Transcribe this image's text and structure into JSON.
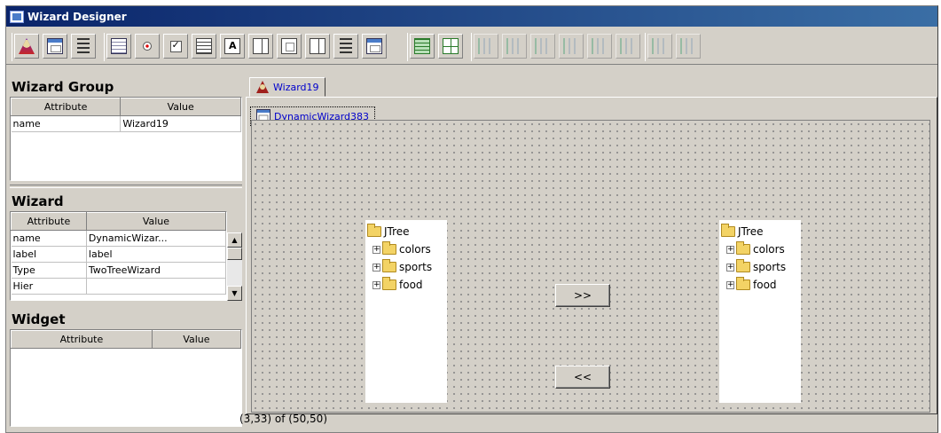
{
  "window": {
    "title": "Wizard Designer"
  },
  "toolbar": {
    "groups": [
      [
        "wizard-icon",
        "dialog-icon",
        "tree-icon"
      ],
      [
        "form-icon",
        "radio-icon",
        "checkbox-icon",
        "list-icon",
        "textarea-icon",
        "column-icon",
        "box-icon",
        "split-icon",
        "tree-list-icon",
        "panel-icon"
      ],
      [
        "grid-green-icon",
        "grid-table-icon"
      ],
      [
        "align-left-icon",
        "align-center-icon",
        "align-right-icon",
        "align-top-icon",
        "align-middle-icon",
        "align-bottom-icon"
      ],
      [
        "same-width-icon",
        "same-height-icon"
      ]
    ]
  },
  "wizard_group": {
    "title": "Wizard Group",
    "headers": [
      "Attribute",
      "Value"
    ],
    "rows": [
      [
        "name",
        "Wizard19"
      ]
    ]
  },
  "wizard": {
    "title": "Wizard",
    "headers": [
      "Attribute",
      "Value"
    ],
    "rows": [
      [
        "name",
        "DynamicWizar..."
      ],
      [
        "label",
        "label"
      ],
      [
        "Type",
        "TwoTreeWizard"
      ],
      [
        "Hier",
        ""
      ]
    ]
  },
  "widget": {
    "title": "Widget",
    "headers": [
      "Attribute",
      "Value"
    ]
  },
  "tabs": {
    "outer": "Wizard19",
    "inner": "DynamicWizard383"
  },
  "trees": {
    "left": {
      "root": "JTree",
      "children": [
        "colors",
        "sports",
        "food"
      ]
    },
    "right": {
      "root": "JTree",
      "children": [
        "colors",
        "sports",
        "food"
      ]
    }
  },
  "buttons": {
    "move_right": ">>",
    "move_left": "<<"
  },
  "status": {
    "text": "(3,33) of (50,50)"
  }
}
